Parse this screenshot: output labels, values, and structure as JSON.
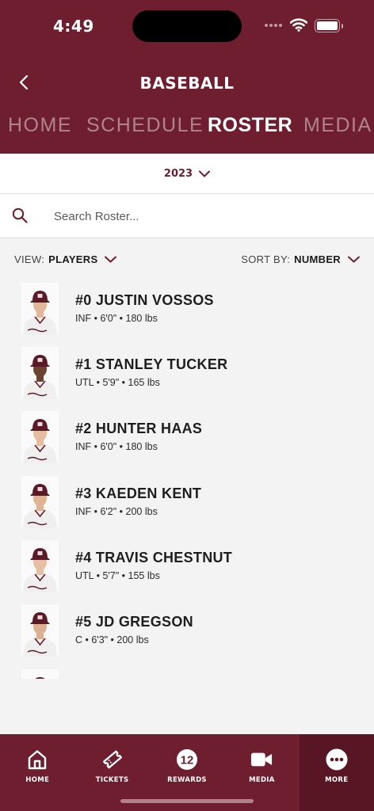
{
  "status_bar": {
    "time": "4:49"
  },
  "header": {
    "title": "BASEBALL"
  },
  "tabs": [
    {
      "label": "HOME"
    },
    {
      "label": "SCHEDULE"
    },
    {
      "label": "ROSTER"
    },
    {
      "label": "MEDIA"
    }
  ],
  "active_tab": "ROSTER",
  "season": {
    "year": "2023"
  },
  "search": {
    "placeholder": "Search Roster..."
  },
  "filters": {
    "view_label": "VIEW:",
    "view_value": "PLAYERS",
    "sort_label": "SORT BY:",
    "sort_value": "NUMBER"
  },
  "roster": [
    {
      "name": "#0 JUSTIN VOSSOS",
      "details": "INF • 6'0\" • 180 lbs"
    },
    {
      "name": "#1 STANLEY TUCKER",
      "details": "UTL • 5'9\" • 165 lbs"
    },
    {
      "name": "#2 HUNTER HAAS",
      "details": "INF • 6'0\" • 180 lbs"
    },
    {
      "name": "#3 KAEDEN KENT",
      "details": "INF • 6'2\" • 200 lbs"
    },
    {
      "name": "#4 TRAVIS CHESTNUT",
      "details": "UTL • 5'7\" • 155 lbs"
    },
    {
      "name": "#5 JD GREGSON",
      "details": "C • 6'3\" • 200 lbs"
    }
  ],
  "bottom_nav": [
    {
      "label": "HOME",
      "icon": "home-icon"
    },
    {
      "label": "TICKETS",
      "icon": "ticket-icon"
    },
    {
      "label": "REWARDS",
      "icon": "rewards-12-icon",
      "badge": "12"
    },
    {
      "label": "MEDIA",
      "icon": "video-camera-icon"
    },
    {
      "label": "MORE",
      "icon": "more-dots-icon"
    }
  ],
  "colors": {
    "brand": "#6e1e2f",
    "brand_dark": "#581624",
    "background": "#f3f3f3",
    "cap": "#5b1a28",
    "jersey": "#f0efef"
  }
}
